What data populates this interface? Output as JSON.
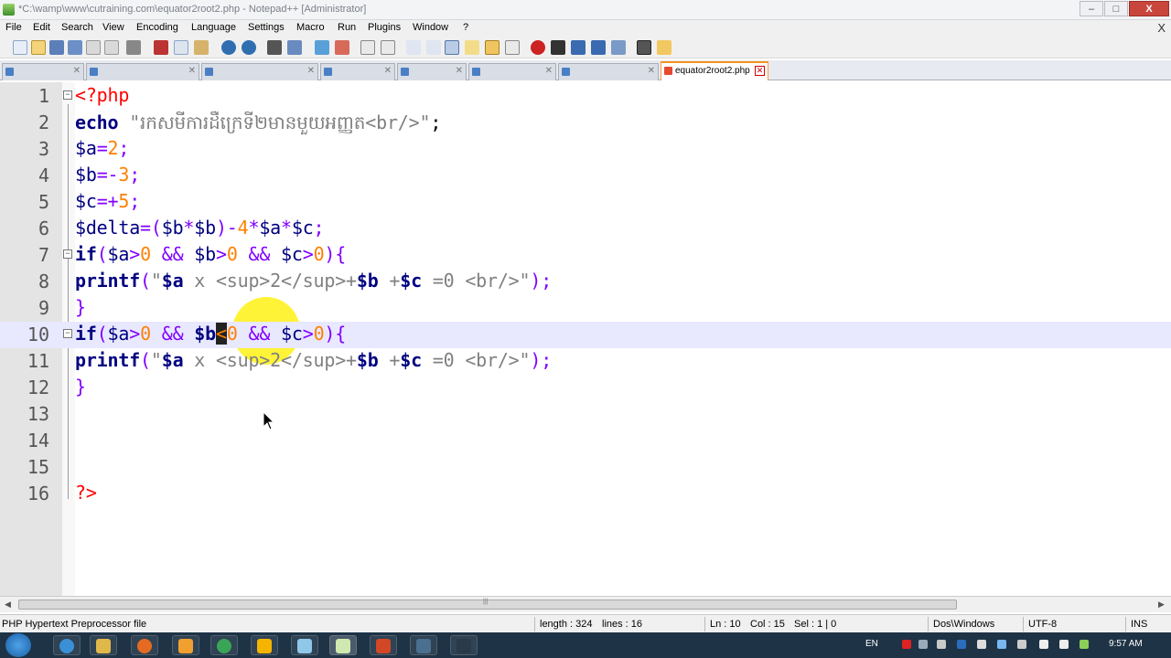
{
  "window": {
    "title": "*C:\\wamp\\www\\cutraining.com\\equator2root2.php - Notepad++ [Administrator]",
    "minimize_label": "‒",
    "maximize_label": "□",
    "close_label": "X"
  },
  "menu": {
    "items": [
      "File",
      "Edit",
      "Search",
      "View",
      "Encoding",
      "Language",
      "Settings",
      "Macro",
      "Run",
      "Plugins",
      "Window",
      "?"
    ],
    "close_label": "X"
  },
  "tabs": {
    "active_label": "equator2root2.php",
    "close_label": "✕"
  },
  "editor": {
    "line_numbers": [
      "1",
      "2",
      "3",
      "4",
      "5",
      "6",
      "7",
      "8",
      "9",
      "10",
      "11",
      "12",
      "13",
      "14",
      "15",
      "16"
    ],
    "current_line": 10,
    "lines": [
      "<?php",
      "echo \"រកសមីការដឺក្រេទី២មានមួយអញ្ញត<br/>\";",
      "$a=2;",
      "$b=-3;",
      "$c=+5;",
      "$delta=($b*$b)-4*$a*$c;",
      "if($a>0 && $b>0 && $c>0){",
      "printf(\"$a x <sup>2</sup>+$b +$c =0 <br/>\");",
      "}",
      "if($a>0 && $b<0 && $c>0){",
      "printf(\"$a x <sup>2</sup>+$b +$c =0 <br/>\");",
      "}",
      "",
      "",
      "",
      "?>"
    ],
    "cursor_char": "<",
    "accent_color": "#f5d300"
  },
  "status": {
    "file_type": "PHP Hypertext Preprocessor file",
    "length": "length : 324",
    "lines": "lines : 16",
    "ln": "Ln : 10",
    "col": "Col : 15",
    "sel": "Sel : 1 | 0",
    "eol": "Dos\\Windows",
    "encoding": "UTF-8",
    "mode": "INS"
  },
  "taskbar": {
    "language": "EN",
    "clock": "9:57 AM"
  }
}
